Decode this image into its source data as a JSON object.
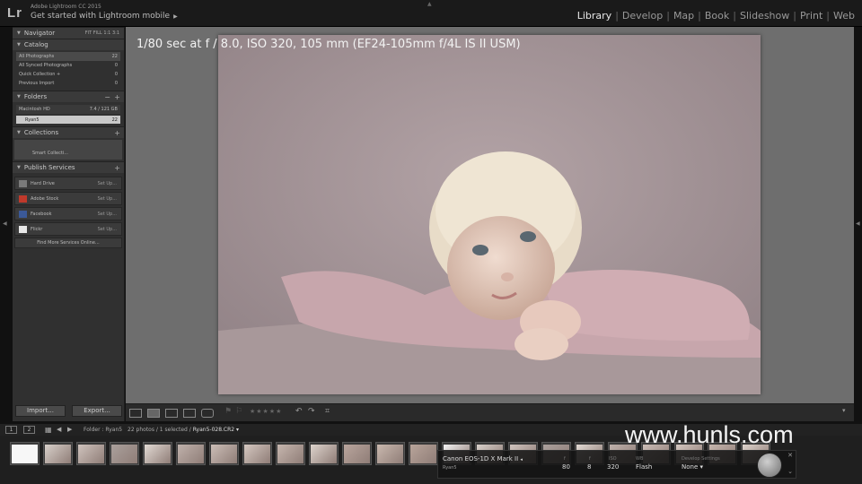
{
  "app": {
    "logo": "Lr",
    "title": "Adobe Lightroom CC 2015",
    "mobile_link": "Get started with Lightroom mobile",
    "modules": [
      "Library",
      "Develop",
      "Map",
      "Book",
      "Slideshow",
      "Print",
      "Web"
    ],
    "active_module": "Library"
  },
  "navigator": {
    "label": "Navigator",
    "zoom_options": [
      "FIT",
      "FILL",
      "1:1",
      "3:1"
    ]
  },
  "catalog": {
    "label": "Catalog",
    "items": [
      {
        "label": "All Photographs",
        "count": "22"
      },
      {
        "label": "All Synced Photographs",
        "count": "0"
      },
      {
        "label": "Quick Collection +",
        "count": "0"
      },
      {
        "label": "Previous Import",
        "count": "0"
      }
    ]
  },
  "folders": {
    "label": "Folders",
    "volume": {
      "name": "Macintosh HD",
      "space": "7.4 / 121 GB"
    },
    "folder": {
      "name": "Ryan5",
      "count": "22"
    }
  },
  "collections": {
    "label": "Collections",
    "item": "Smart Collecti..."
  },
  "publish": {
    "label": "Publish Services",
    "services": [
      {
        "name": "Hard Drive",
        "action": "Set Up...",
        "icon_color": "#7a7a7a"
      },
      {
        "name": "Adobe Stock",
        "action": "Set Up...",
        "icon_color": "#c0392b"
      },
      {
        "name": "Facebook",
        "action": "Set Up...",
        "icon_color": "#3b5998"
      },
      {
        "name": "Flickr",
        "action": "Set Up...",
        "icon_color": "#e8e8e8"
      }
    ],
    "find_more": "Find More Services Online..."
  },
  "left_buttons": {
    "import": "Import...",
    "export": "Export..."
  },
  "loupe": {
    "info": "1/80 sec at f / 8.0, ISO 320, 105 mm (EF24-105mm f/4L IS II USM)"
  },
  "toolbar": {
    "stars": "★★★★★"
  },
  "filmstrip": {
    "screens": [
      "1",
      "2"
    ],
    "source": "Folder : Ryan5",
    "count": "22 photos / 1 selected /",
    "filename": "Ryan5-028.CR2 ▾",
    "thumbnails": 23
  },
  "watermark": "www.hunls.com",
  "hud": {
    "camera": "Canon EOS-1D X Mark II",
    "owner": "Ryan5",
    "cols": [
      {
        "label": "f",
        "value": "80"
      },
      {
        "label": "f",
        "value": "8"
      },
      {
        "label": "ISO",
        "value": "320"
      },
      {
        "label": "WB",
        "value": "Flash"
      },
      {
        "label": "Develop Settings",
        "value": "None ▾"
      }
    ]
  }
}
